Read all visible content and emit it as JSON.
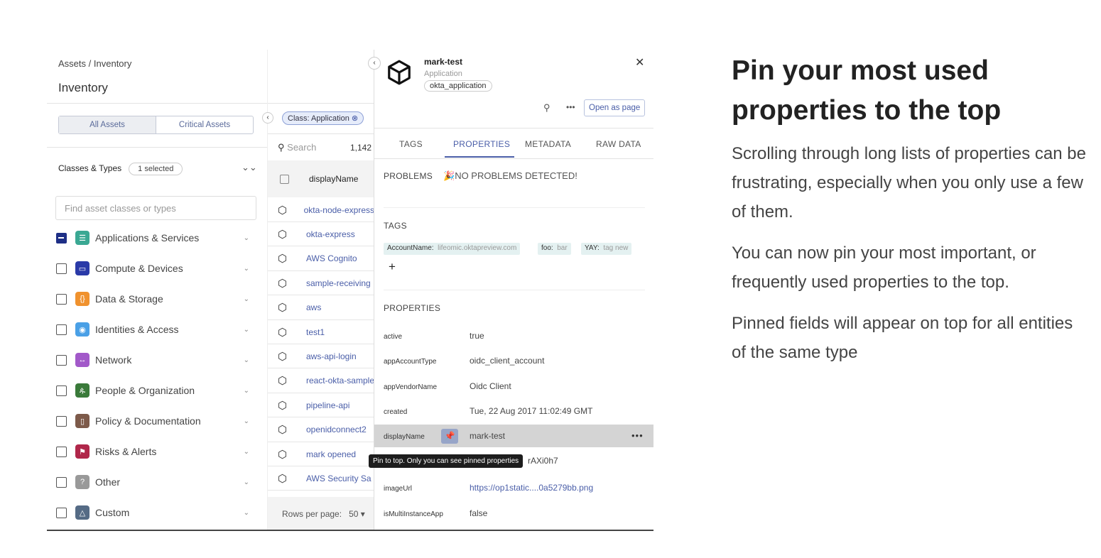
{
  "breadcrumb": {
    "root": "Assets",
    "sep": "/",
    "current": "Inventory"
  },
  "page_title": "Inventory",
  "segments": [
    "All Assets",
    "Critical Assets"
  ],
  "classes": {
    "label": "Classes & Types",
    "selected": "1 selected",
    "search_placeholder": "Find asset classes or types",
    "items": [
      {
        "label": "Applications & Services",
        "color": "#3aa893",
        "glyph": "☰",
        "checked": "indeterminate"
      },
      {
        "label": "Compute & Devices",
        "color": "#2a3aa8",
        "glyph": "▭"
      },
      {
        "label": "Data & Storage",
        "color": "#f0922e",
        "glyph": "{}"
      },
      {
        "label": "Identities & Access",
        "color": "#4aa0e6",
        "glyph": "◉"
      },
      {
        "label": "Network",
        "color": "#a259c9",
        "glyph": "↔"
      },
      {
        "label": "People & Organization",
        "color": "#3a7a3a",
        "glyph": "ዹ"
      },
      {
        "label": "Policy & Documentation",
        "color": "#7d5a4a",
        "glyph": "▯"
      },
      {
        "label": "Risks & Alerts",
        "color": "#b0274a",
        "glyph": "⚑"
      },
      {
        "label": "Other",
        "color": "#999999",
        "glyph": "?"
      },
      {
        "label": "Custom",
        "color": "#556b85",
        "glyph": "△"
      }
    ]
  },
  "filter_chip": "Class: Application",
  "table": {
    "search_placeholder": "Search",
    "count": "1,142",
    "column": "displayName",
    "rows": [
      "okta-node-express",
      "okta-express",
      "AWS Cognito",
      "sample-receiving",
      "aws",
      "test1",
      "aws-api-login",
      "react-okta-sample",
      "pipeline-api",
      "openidconnect2",
      "mark opened",
      "AWS Security Sa"
    ],
    "rows_per_page_label": "Rows per page:",
    "rows_per_page": "50"
  },
  "detail": {
    "name": "mark-test",
    "class": "Application",
    "type": "okta_application",
    "open_page": "Open as page",
    "tabs": [
      "TAGS",
      "PROPERTIES",
      "METADATA",
      "RAW DATA"
    ],
    "active_tab": "PROPERTIES",
    "problems_label": "PROBLEMS",
    "problems_value": "NO PROBLEMS DETECTED!",
    "tags_label": "TAGS",
    "tags": [
      {
        "k": "AccountName:",
        "v": "lifeomic.oktapreview.com"
      },
      {
        "k": "foo:",
        "v": "bar"
      },
      {
        "k": "YAY:",
        "v": "tag new"
      }
    ],
    "add": "+",
    "properties_label": "PROPERTIES",
    "properties": [
      {
        "k": "active",
        "v": "true"
      },
      {
        "k": "appAccountType",
        "v": "oidc_client_account"
      },
      {
        "k": "appVendorName",
        "v": "Oidc Client"
      },
      {
        "k": "created",
        "v": "Tue, 22 Aug 2017 11:02:49 GMT"
      },
      {
        "k": "displayName",
        "v": "mark-test"
      },
      {
        "k": "",
        "v": "rAXi0h7"
      },
      {
        "k": "imageUrl",
        "v": "https://op1static....0a5279bb.png"
      },
      {
        "k": "isMultiInstanceApp",
        "v": "false"
      }
    ],
    "tooltip": "Pin to top. Only you can see pinned properties"
  },
  "promo": {
    "heading": "Pin your most used properties to the top",
    "paragraphs": [
      "Scrolling through long lists of properties can be frustrating, especially when you only use a few of them.",
      "You can now pin your most important, or frequently used properties to the top.",
      "Pinned fields will appear on top for all entities of the same type"
    ]
  }
}
